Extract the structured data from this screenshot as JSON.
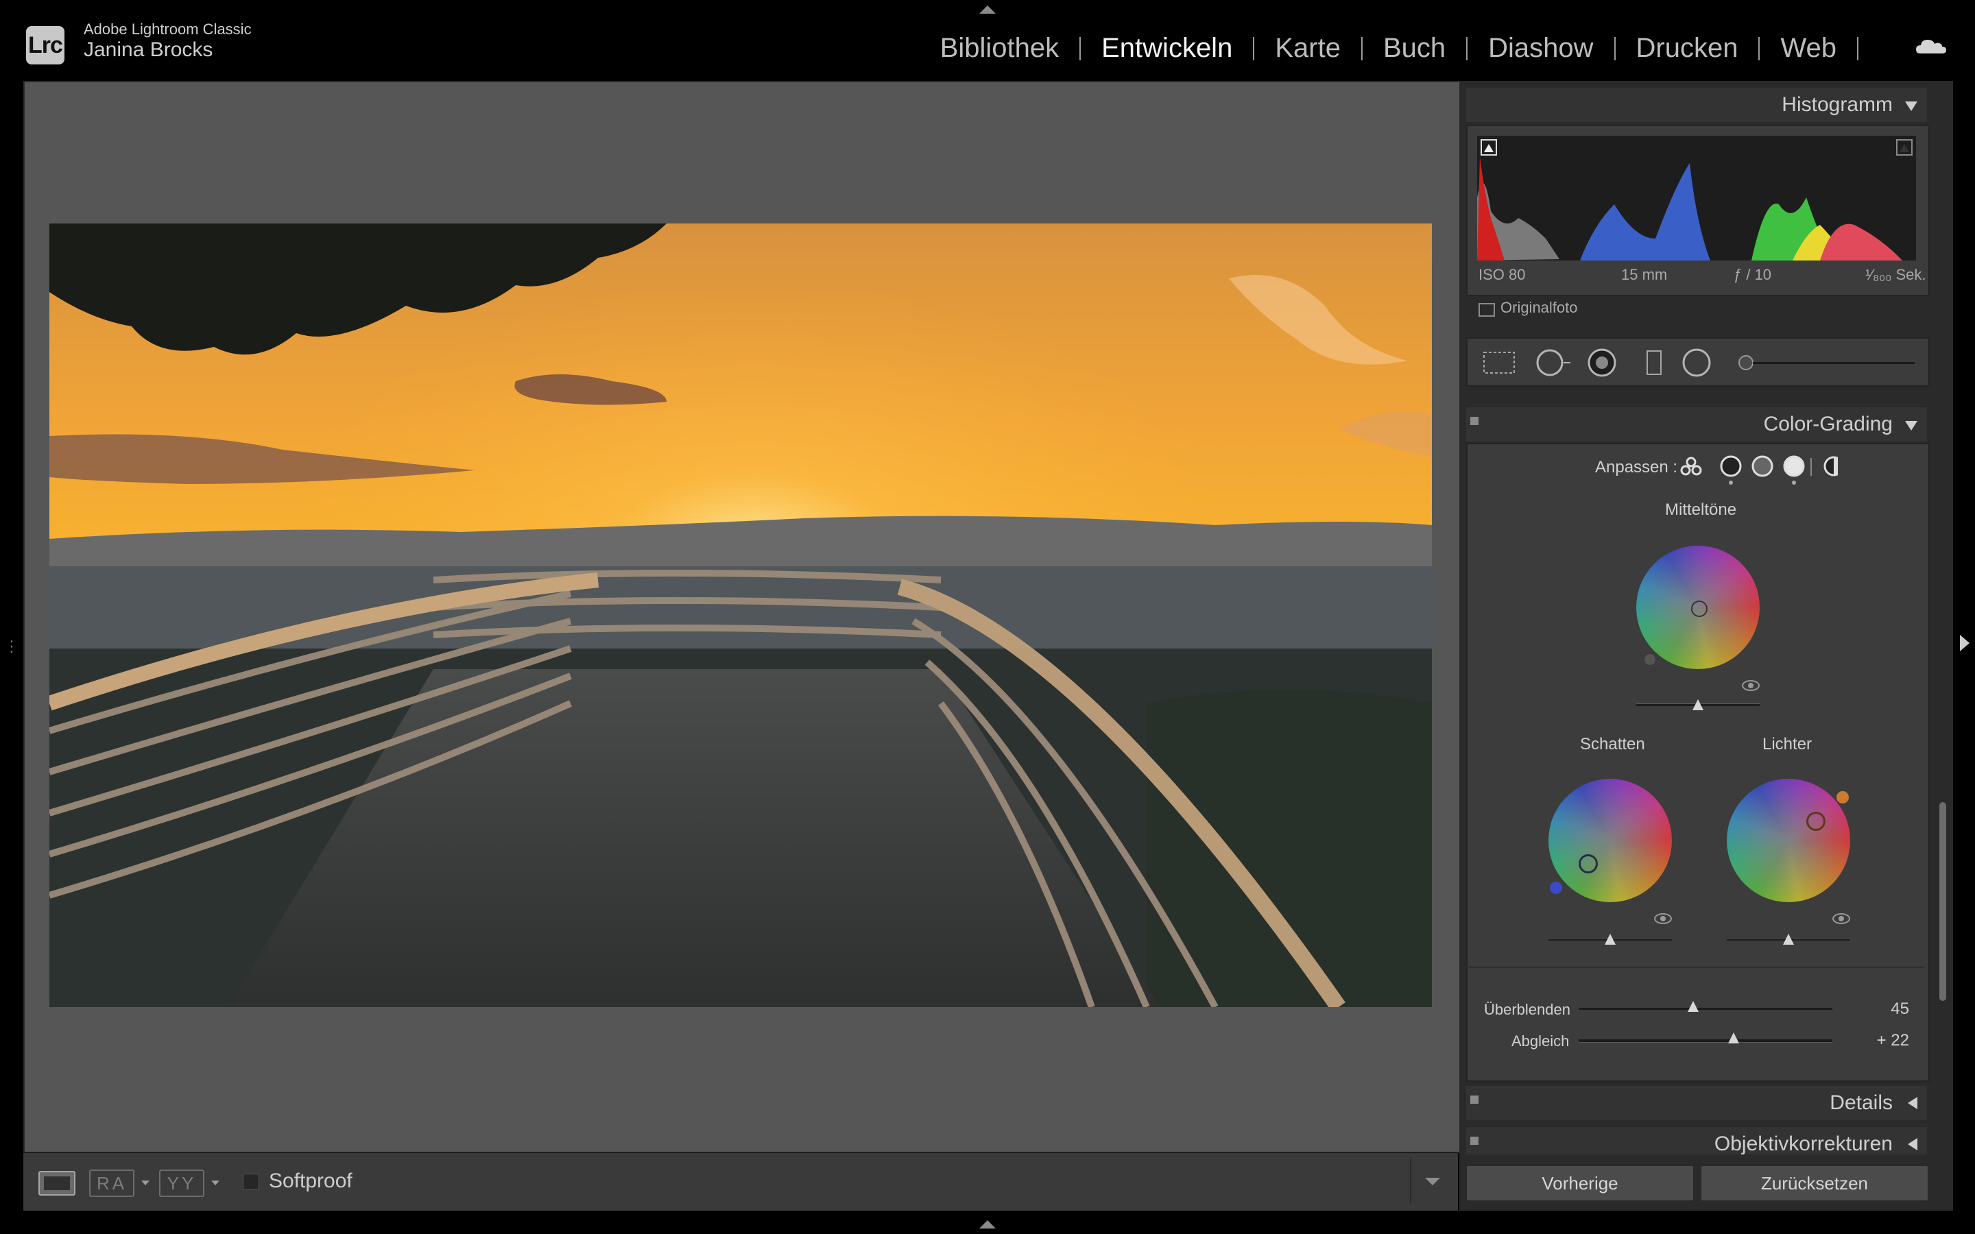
{
  "app": {
    "logo": "Lrc",
    "product": "Adobe Lightroom Classic",
    "user": "Janina Brocks"
  },
  "modules": [
    {
      "label": "Bibliothek",
      "active": false
    },
    {
      "label": "Entwickeln",
      "active": true
    },
    {
      "label": "Karte",
      "active": false
    },
    {
      "label": "Buch",
      "active": false
    },
    {
      "label": "Diashow",
      "active": false
    },
    {
      "label": "Drucken",
      "active": false
    },
    {
      "label": "Web",
      "active": false
    }
  ],
  "toolbar": {
    "ra_label": "RA",
    "yy_label": "YY",
    "softproof_label": "Softproof",
    "softproof_checked": false
  },
  "histogram": {
    "title": "Histogramm",
    "iso": "ISO 80",
    "focal": "15 mm",
    "aperture": "ƒ / 10",
    "shutter": "¹⁄₈₀₀ Sek.",
    "original_label": "Originalfoto"
  },
  "color_grading": {
    "title": "Color-Grading",
    "adjust_label": "Anpassen :",
    "midtones_label": "Mitteltöne",
    "shadows_label": "Schatten",
    "highlights_label": "Lichter",
    "blend_label": "Überblenden",
    "blend_value": "45",
    "blend_fraction": 0.45,
    "balance_label": "Abgleich",
    "balance_value": "+ 22",
    "balance_fraction": 0.61
  },
  "panels": {
    "details": "Details",
    "lens": "Objektivkorrekturen"
  },
  "buttons": {
    "previous": "Vorherige",
    "reset": "Zurücksetzen"
  },
  "colors": {
    "accent_orange": "#f0a030",
    "panel_bg": "#3c3c3c",
    "viewport_bg": "#565656"
  }
}
